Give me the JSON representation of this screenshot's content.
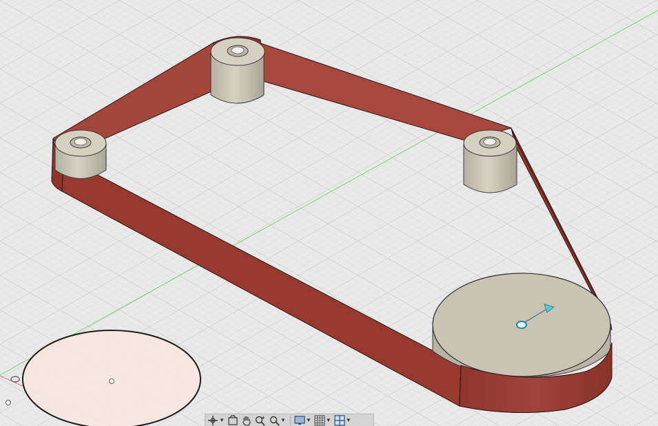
{
  "viewport": {
    "background": "#e9e9e9",
    "belt_color": "#9b3c33",
    "pulley_color": "#c9c3b3",
    "sketch_fill": "#f6e7df",
    "x_axis_color": "#d85050",
    "z_axis_color": "#4fcf4f"
  },
  "toolbar": {
    "items": [
      {
        "name": "orbit-icon",
        "dropdown": true
      },
      {
        "name": "look-at-icon",
        "dropdown": false
      },
      {
        "name": "pan-hand-icon",
        "dropdown": false
      },
      {
        "name": "zoom-icon",
        "dropdown": false
      },
      {
        "name": "fit-zoom-icon",
        "dropdown": true
      },
      {
        "name": "display-settings-icon",
        "dropdown": true
      },
      {
        "name": "grid-snaps-icon",
        "dropdown": true
      },
      {
        "name": "viewports-icon",
        "dropdown": true
      }
    ]
  }
}
